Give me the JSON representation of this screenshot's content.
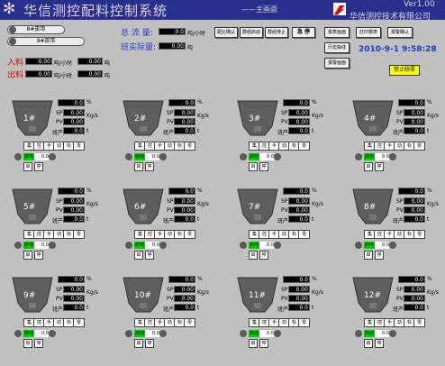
{
  "header": {
    "title": "华信测控配料控制系统",
    "subtitle": "——主画面",
    "version": "Ver1.00",
    "company": "华信测控技术有限公司"
  },
  "belts": [
    "8#皮带",
    "9#皮带"
  ],
  "totals": {
    "flow_label": "总 流 量:",
    "flow_value": "0.0",
    "flow_unit": "吨/小时",
    "actual_label": "班实际量:",
    "actual_value": "0.00",
    "actual_unit": "吨"
  },
  "inflow": {
    "label": "入料",
    "rate": "0.00",
    "rate_unit": "吨/小时",
    "total": "0.00",
    "total_unit": "吨"
  },
  "outflow": {
    "label": "出料",
    "rate": "0.00",
    "rate_unit": "吨/小时",
    "total": "0.00",
    "total_unit": "吨"
  },
  "buttons": {
    "confirm_ratio": "配比确认",
    "group_start": "群组启动",
    "group_stop": "群组停止",
    "emergency": "急 停",
    "report_view": "报表画面",
    "print_report": "打印报表",
    "report_confirm": "报警确认",
    "history_curve": "历史曲线",
    "alarm_view": "报警画面",
    "forbid_zero": "禁止除零"
  },
  "datetime": "2010-9-1 9:58:28",
  "feeder_labels": {
    "sp": "SP",
    "pv": "PV",
    "accum": "班产",
    "pct_unit": "%",
    "rate_unit": "Kg/s",
    "accum_unit": "t",
    "modes": [
      "集",
      "控",
      "手",
      "动",
      "标",
      "零"
    ],
    "s_btn": "启",
    "t_btn": "停"
  },
  "feeders": [
    {
      "name": "1#",
      "pct": "0.0",
      "sp": "0.00",
      "pv": "0.00",
      "accum": "0.0",
      "run": "启动",
      "bar": "0.0"
    },
    {
      "name": "2#",
      "pct": "0.0",
      "sp": "0.00",
      "pv": "0.00",
      "accum": "0.0",
      "run": "启动",
      "bar": "0.0"
    },
    {
      "name": "3#",
      "pct": "0.0",
      "sp": "0.00",
      "pv": "0.00",
      "accum": "0.0",
      "run": "启动",
      "bar": "0.0"
    },
    {
      "name": "4#",
      "pct": "0.0",
      "sp": "0.00",
      "pv": "0.00",
      "accum": "0.0",
      "run": "启动",
      "bar": "0.0"
    },
    {
      "name": "5#",
      "pct": "0.0",
      "sp": "0.00",
      "pv": "0.00",
      "accum": "0.0",
      "run": "启动",
      "bar": "0.0"
    },
    {
      "name": "6#",
      "pct": "0.0",
      "sp": "0.00",
      "pv": "0.00",
      "accum": "0.0",
      "run": "启动",
      "bar": "0.0"
    },
    {
      "name": "7#",
      "pct": "0.0",
      "sp": "0.00",
      "pv": "0.00",
      "accum": "0.0",
      "run": "启动",
      "bar": "0.0"
    },
    {
      "name": "8#",
      "pct": "0.0",
      "sp": "0.00",
      "pv": "0.00",
      "accum": "0.0",
      "run": "启动",
      "bar": "0.0"
    },
    {
      "name": "9#",
      "pct": "0.0",
      "sp": "0.00",
      "pv": "0.00",
      "accum": "0.0",
      "run": "启动",
      "bar": "0.0"
    },
    {
      "name": "10#",
      "pct": "0.0",
      "sp": "0.00",
      "pv": "0.00",
      "accum": "0.0",
      "run": "启动",
      "bar": "0.0"
    },
    {
      "name": "11#",
      "pct": "0.0",
      "sp": "0.00",
      "pv": "0.00",
      "accum": "0.0",
      "run": "启动",
      "bar": "0.0"
    },
    {
      "name": "12#",
      "pct": "0.0",
      "sp": "0.00",
      "pv": "0.00",
      "accum": "0.0",
      "run": "启动",
      "bar": "0.0"
    }
  ]
}
